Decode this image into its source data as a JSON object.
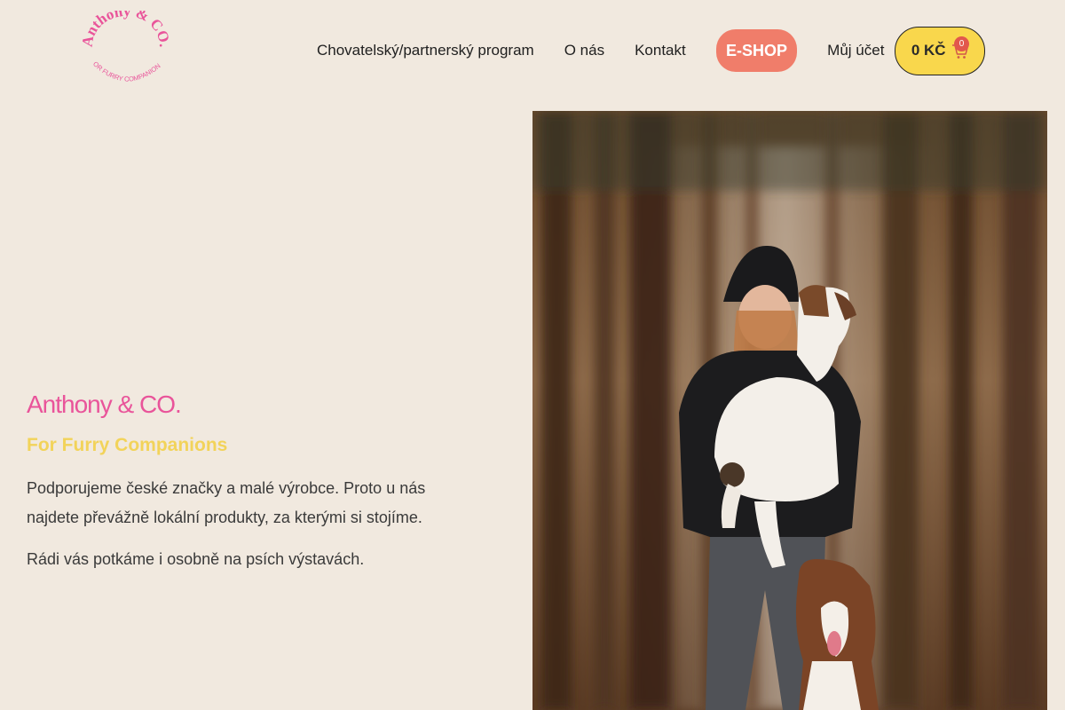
{
  "brand": {
    "logo_text": "Anthony & CO.",
    "logo_tagline": "FOR FURRY COMPANIONS",
    "color_pink": "#e9549a",
    "color_yellow": "#f9d74c",
    "color_coral": "#f07d6a"
  },
  "nav": {
    "items": [
      {
        "label": "Chovatelský/partnerský program"
      },
      {
        "label": "O nás"
      },
      {
        "label": "Kontakt"
      }
    ],
    "eshop_label": "E-SHOP",
    "account_label": "Můj účet",
    "cart_total": "0 KČ",
    "cart_count": "0",
    "cart_icon": "shopping-cart-icon"
  },
  "hero": {
    "title": "Anthony & CO.",
    "subtitle": "For Furry Companions",
    "paragraph1": "Podporujeme české značky a malé výrobce. Proto u nás najdete převážně lokální produkty, za kterými si stojíme.",
    "paragraph2": "Rádi vás potkáme i osobně na psích výstavách."
  },
  "photo": {
    "subject": "woman in black beanie holding white borzoi dog with australian shepherd in forest"
  }
}
